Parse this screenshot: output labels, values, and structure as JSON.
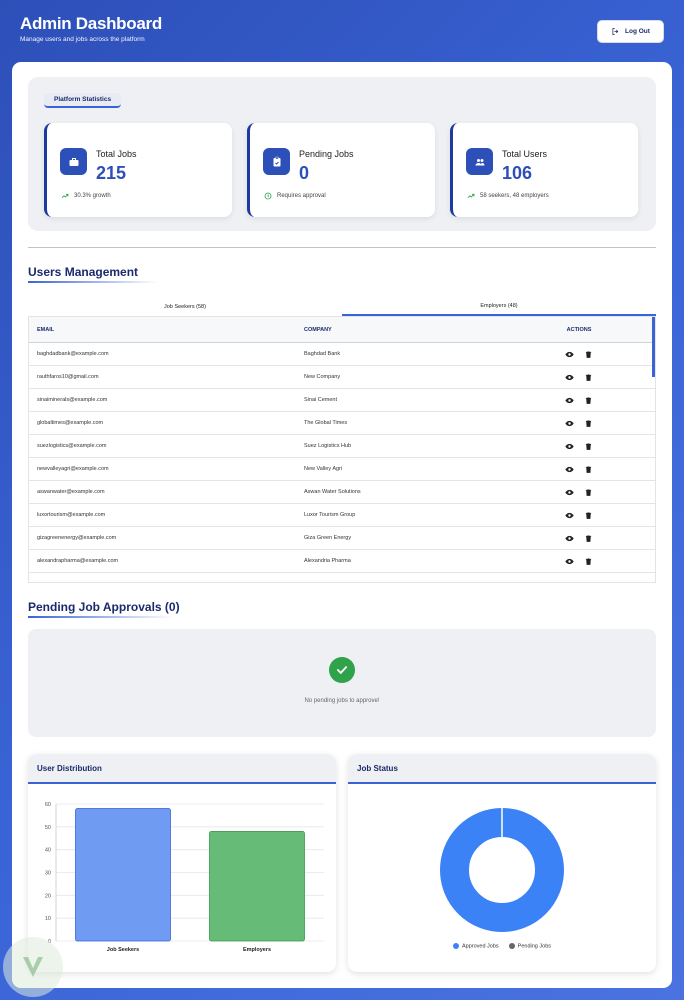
{
  "header": {
    "title": "Admin Dashboard",
    "subtitle": "Manage users and jobs across the platform",
    "logout_label": "Log Out"
  },
  "stats": {
    "section_label": "Platform Statistics",
    "cards": [
      {
        "label": "Total Jobs",
        "value": "215",
        "sub": "30.3% growth",
        "icon": "briefcase-icon",
        "sub_icon": "trend-up-icon"
      },
      {
        "label": "Pending Jobs",
        "value": "0",
        "sub": "Requires approval",
        "icon": "clipboard-icon",
        "sub_icon": "clock-icon"
      },
      {
        "label": "Total Users",
        "value": "106",
        "sub": "58 seekers, 48 employers",
        "icon": "people-icon",
        "sub_icon": "trend-up-icon"
      }
    ]
  },
  "users": {
    "title": "Users Management",
    "tabs": [
      "Job Seekers (58)",
      "Employers (48)"
    ],
    "active_tab": 1,
    "columns": [
      "EMAIL",
      "COMPANY",
      "ACTIONS"
    ],
    "rows": [
      {
        "email": "baghdadbank@example.com",
        "company": "Baghdad Bank"
      },
      {
        "email": "rauthfaros10@gmail.com",
        "company": "New Company"
      },
      {
        "email": "sinaiminerals@example.com",
        "company": "Sinai Cement"
      },
      {
        "email": "globaltimes@example.com",
        "company": "The Global Times"
      },
      {
        "email": "suezlogistics@example.com",
        "company": "Suez Logistics Hub"
      },
      {
        "email": "newvalleyagri@example.com",
        "company": "New Valley Agri"
      },
      {
        "email": "aswanwater@example.com",
        "company": "Aswan Water Solutions"
      },
      {
        "email": "luxortourism@example.com",
        "company": "Luxor Tourism Group"
      },
      {
        "email": "gizagreenenergy@example.com",
        "company": "Giza Green Energy"
      },
      {
        "email": "alexandrapharma@example.com",
        "company": "Alexandria Pharma"
      }
    ]
  },
  "pending": {
    "title": "Pending Job Approvals (0)",
    "empty_text": "No pending jobs to approve!"
  },
  "colors": {
    "accent": "#3a64d6",
    "navy": "#1a2a6c",
    "bar_seekers": "#6f9cf2",
    "bar_employers": "#66bb77",
    "approved": "#3b82f6",
    "pending": "#666666"
  },
  "chart_data": [
    {
      "type": "bar",
      "title": "User Distribution",
      "categories": [
        "Job Seekers",
        "Employers"
      ],
      "values": [
        58,
        48
      ],
      "ylim": [
        0,
        60
      ],
      "yticks": [
        0,
        10,
        20,
        30,
        40,
        50,
        60
      ],
      "grid": true
    },
    {
      "type": "pie",
      "title": "Job Status",
      "labels": [
        "Approved Jobs",
        "Pending Jobs"
      ],
      "values": [
        215,
        0
      ],
      "legend": "bottom"
    }
  ]
}
